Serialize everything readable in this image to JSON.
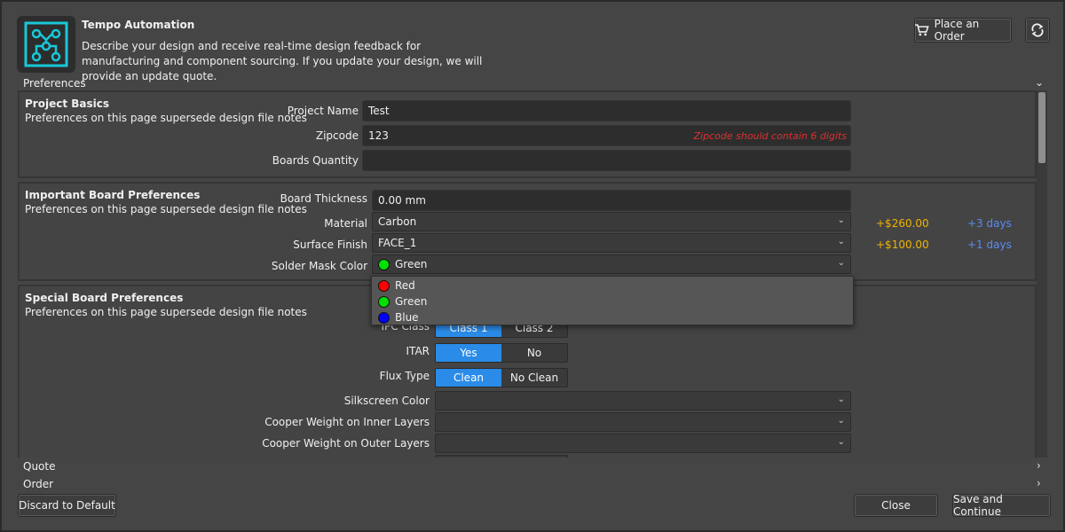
{
  "header": {
    "app_title": "Tempo Automation",
    "description": "Describe your design and receive real-time design feedback for manufacturing and component sourcing. If you update your design, we will provide an update quote.",
    "place_order_label": "Place an Order"
  },
  "sections": {
    "preferences": "Preferences",
    "quote": "Quote",
    "order": "Order"
  },
  "project_basics": {
    "title": "Project Basics",
    "subtitle": "Preferences on this page supersede design file notes",
    "project_name_label": "Project Name",
    "project_name_value": "Test",
    "zipcode_label": "Zipcode",
    "zipcode_value": "123",
    "zipcode_error": "Zipcode should contain 6 digits",
    "boards_quantity_label": "Boards Quantity",
    "boards_quantity_value": ""
  },
  "important": {
    "title": "Important Board Preferences",
    "subtitle": "Preferences on this page supersede design file notes",
    "board_thickness_label": "Board Thickness",
    "board_thickness_value": "0.00 mm",
    "material_label": "Material",
    "material_value": "Carbon",
    "material_price": "+$260.00",
    "material_days": "+3 days",
    "surface_finish_label": "Surface Finish",
    "surface_finish_value": "FACE_1",
    "surface_price": "+$100.00",
    "surface_days": "+1 days",
    "solder_mask_label": "Solder Mask Color",
    "solder_mask_value": "Green"
  },
  "solder_mask_options": [
    {
      "label": "Red",
      "color": "#ff0000"
    },
    {
      "label": "Green",
      "color": "#00e000"
    },
    {
      "label": "Blue",
      "color": "#0000ff"
    }
  ],
  "special": {
    "title": "Special Board Preferences",
    "subtitle": "Preferences on this page supersede design file notes",
    "ipc_label": "IPC Class",
    "ipc_options": [
      "Class 1",
      "Class 2"
    ],
    "itar_label": "ITAR",
    "itar_options": [
      "Yes",
      "No"
    ],
    "flux_label": "Flux Type",
    "flux_options": [
      "Clean",
      "No Clean"
    ],
    "silkscreen_label": "Silkscreen Color",
    "inner_label": "Cooper Weight on Inner Layers",
    "outer_label": "Cooper Weight on Outer Layers"
  },
  "footer": {
    "discard_label": "Discard to Default",
    "close_label": "Close",
    "save_label": "Save and Continue"
  },
  "colors": {
    "accent": "#2a8be8",
    "error": "#e03030",
    "price": "#f0b400",
    "days": "#5b8cf0"
  }
}
